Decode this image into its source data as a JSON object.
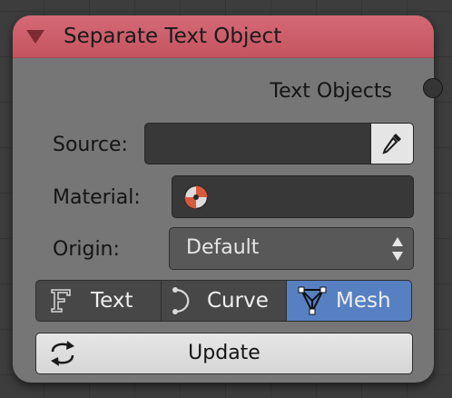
{
  "node": {
    "title": "Separate Text Object",
    "output_label": "Text Objects",
    "header_color": "#c9606b"
  },
  "fields": {
    "source_label": "Source:",
    "source_value": "",
    "material_label": "Material:",
    "material_value": "",
    "origin_label": "Origin:",
    "origin_value": "Default"
  },
  "mode_buttons": [
    {
      "label": "Text",
      "icon": "text-font-icon",
      "selected": false
    },
    {
      "label": "Curve",
      "icon": "curve-icon",
      "selected": false
    },
    {
      "label": "Mesh",
      "icon": "mesh-icon",
      "selected": true
    }
  ],
  "update_button": {
    "label": "Update",
    "icon": "refresh-icon"
  },
  "colors": {
    "selected": "#5680c2",
    "node_body": "#767676"
  }
}
